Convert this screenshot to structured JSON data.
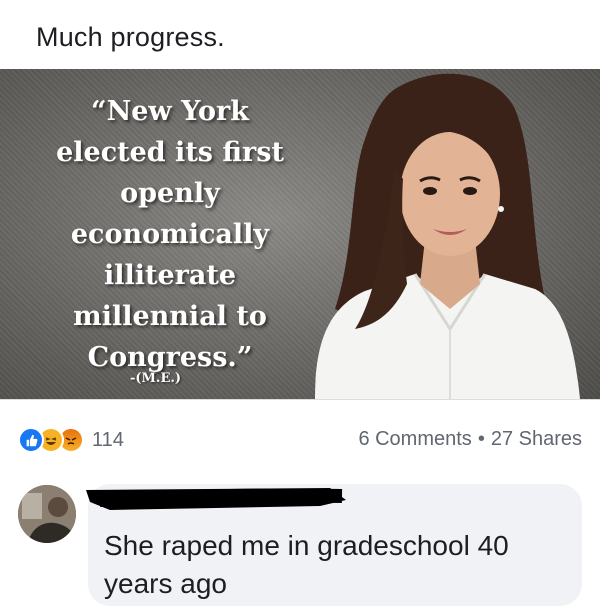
{
  "post": {
    "caption": "Much progress."
  },
  "meme": {
    "quote_lines": [
      "“New York",
      "elected its first",
      "openly",
      "economically",
      "illiterate",
      "millennial to",
      "Congress.”"
    ],
    "attribution": "-(M.E.)"
  },
  "engagement": {
    "reactions": [
      "like-icon",
      "haha-icon",
      "angry-icon"
    ],
    "reaction_count": "114",
    "comments": "6 Comments",
    "separator": "•",
    "shares": "27 Shares"
  },
  "comment": {
    "text": "She raped me in gradeschool 40 years ago"
  },
  "colors": {
    "like": "#1877f2",
    "haha": "#f7b125",
    "angry": "#e9710f",
    "bubble": "#f0f2f5",
    "muted_text": "#606770"
  }
}
